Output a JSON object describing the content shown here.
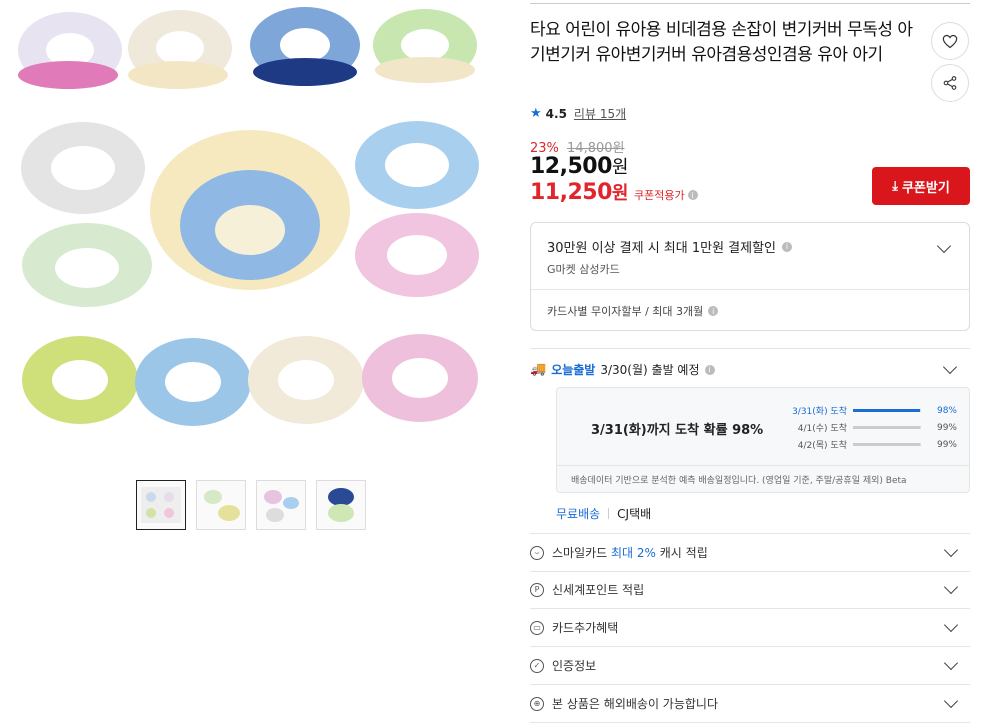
{
  "product": {
    "title": "타요 어린이 유아용 비데겸용 손잡이 변기커버 무독성 아기변기커 유아변기커버 유아겸용성인겸용 유아 아기",
    "rating": "4.5",
    "reviews": "리뷰 15개",
    "discount_pct": "23%",
    "original_price": "14,800원",
    "price_num": "12,500",
    "price_unit": "원",
    "coupon_price_num": "11,250",
    "coupon_price_unit": "원",
    "coupon_applied_label": "쿠폰적용가",
    "coupon_button": "쿠폰받기"
  },
  "card_promo": {
    "title": "30만원 이상 결제 시 최대 1만원 결제할인",
    "subtitle": "G마켓 삼성카드",
    "installment": "카드사별 무이자할부 / 최대 3개월"
  },
  "shipping": {
    "today_label": "오늘출발",
    "ship_date": "3/30(월) 출발 예정",
    "arrival_headline": "3/31(화)까지 도착 확률 98%",
    "probabilities": [
      {
        "date": "3/31(화) 도착",
        "pct": "98%",
        "value": 98
      },
      {
        "date": "4/1(수) 도착",
        "pct": "99%",
        "value": 99
      },
      {
        "date": "4/2(목) 도착",
        "pct": "99%",
        "value": 99
      }
    ],
    "note": "배송데이터 기반으로 분석한 예측 배송일정입니다. (영업일 기준, 주말/공휴일 제외) Beta",
    "fee": "무료배송",
    "carrier": "CJ택배"
  },
  "benefits": [
    {
      "icon": "smile-card-icon",
      "glyph": "⌣",
      "pre": "스마일카드 ",
      "hl": "최대 2%",
      "post": " 캐시 적립"
    },
    {
      "icon": "points-icon",
      "glyph": "P",
      "pre": "신세계포인트 적립",
      "hl": "",
      "post": ""
    },
    {
      "icon": "card-icon",
      "glyph": "▭",
      "pre": "카드추가혜택",
      "hl": "",
      "post": ""
    },
    {
      "icon": "shield-check-icon",
      "glyph": "✓",
      "pre": "인증정보",
      "hl": "",
      "post": ""
    },
    {
      "icon": "globe-icon",
      "glyph": "⊕",
      "pre": "본 상품은 해외배송이 가능합니다",
      "hl": "",
      "post": ""
    }
  ],
  "colors": {
    "accent_red": "#d9161c",
    "accent_blue": "#1a6dd4"
  }
}
